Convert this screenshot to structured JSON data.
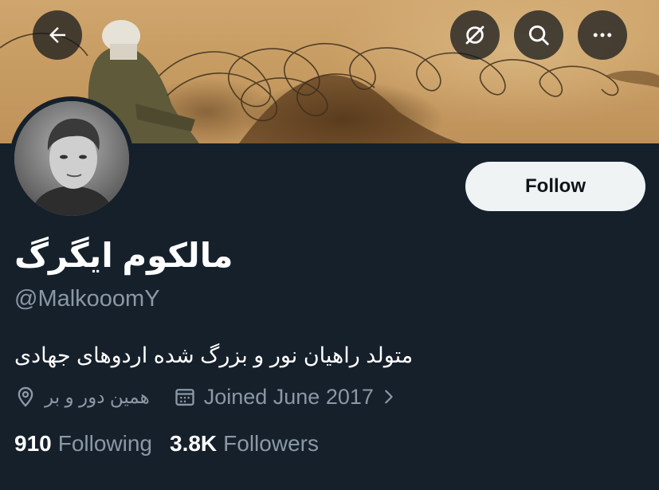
{
  "header": {
    "back_icon": "arrow-left-icon",
    "translate_icon": "translate-off-icon",
    "search_icon": "search-icon",
    "more_icon": "more-horizontal-icon"
  },
  "profile": {
    "display_name": "مالکوم ایگرگ",
    "handle": "@MalkooomY",
    "bio": "متولد راهیان نور و بزرگ شده اردوهای جهادی",
    "location": "همین دور و بر",
    "joined": "Joined June 2017",
    "follow_label": "Follow"
  },
  "stats": {
    "following_count": "910",
    "following_label": "Following",
    "followers_count": "3.8K",
    "followers_label": "Followers"
  },
  "colors": {
    "background": "#15202b",
    "secondary_text": "#8b98a5",
    "follow_button_bg": "#eff3f4"
  }
}
